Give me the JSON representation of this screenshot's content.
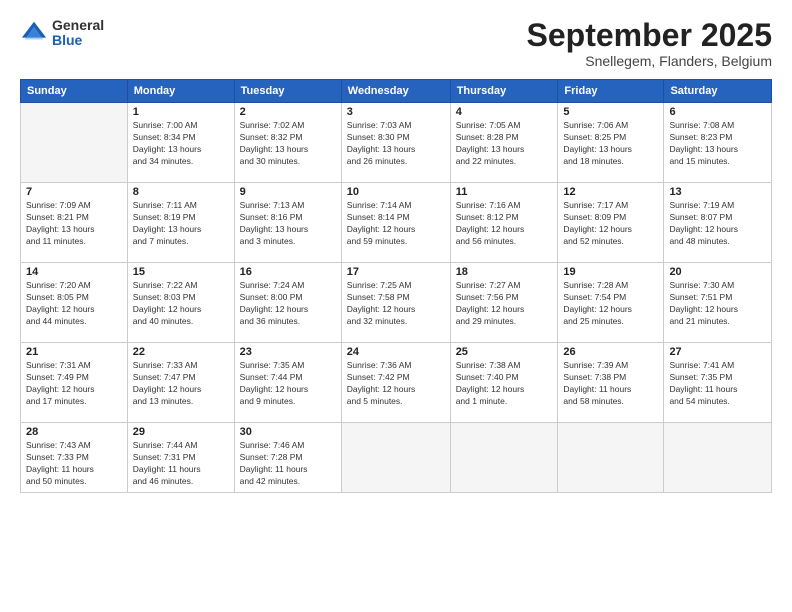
{
  "header": {
    "logo_general": "General",
    "logo_blue": "Blue",
    "month_title": "September 2025",
    "location": "Snellegem, Flanders, Belgium"
  },
  "weekdays": [
    "Sunday",
    "Monday",
    "Tuesday",
    "Wednesday",
    "Thursday",
    "Friday",
    "Saturday"
  ],
  "weeks": [
    [
      {
        "day": "",
        "info": ""
      },
      {
        "day": "1",
        "info": "Sunrise: 7:00 AM\nSunset: 8:34 PM\nDaylight: 13 hours\nand 34 minutes."
      },
      {
        "day": "2",
        "info": "Sunrise: 7:02 AM\nSunset: 8:32 PM\nDaylight: 13 hours\nand 30 minutes."
      },
      {
        "day": "3",
        "info": "Sunrise: 7:03 AM\nSunset: 8:30 PM\nDaylight: 13 hours\nand 26 minutes."
      },
      {
        "day": "4",
        "info": "Sunrise: 7:05 AM\nSunset: 8:28 PM\nDaylight: 13 hours\nand 22 minutes."
      },
      {
        "day": "5",
        "info": "Sunrise: 7:06 AM\nSunset: 8:25 PM\nDaylight: 13 hours\nand 18 minutes."
      },
      {
        "day": "6",
        "info": "Sunrise: 7:08 AM\nSunset: 8:23 PM\nDaylight: 13 hours\nand 15 minutes."
      }
    ],
    [
      {
        "day": "7",
        "info": "Sunrise: 7:09 AM\nSunset: 8:21 PM\nDaylight: 13 hours\nand 11 minutes."
      },
      {
        "day": "8",
        "info": "Sunrise: 7:11 AM\nSunset: 8:19 PM\nDaylight: 13 hours\nand 7 minutes."
      },
      {
        "day": "9",
        "info": "Sunrise: 7:13 AM\nSunset: 8:16 PM\nDaylight: 13 hours\nand 3 minutes."
      },
      {
        "day": "10",
        "info": "Sunrise: 7:14 AM\nSunset: 8:14 PM\nDaylight: 12 hours\nand 59 minutes."
      },
      {
        "day": "11",
        "info": "Sunrise: 7:16 AM\nSunset: 8:12 PM\nDaylight: 12 hours\nand 56 minutes."
      },
      {
        "day": "12",
        "info": "Sunrise: 7:17 AM\nSunset: 8:09 PM\nDaylight: 12 hours\nand 52 minutes."
      },
      {
        "day": "13",
        "info": "Sunrise: 7:19 AM\nSunset: 8:07 PM\nDaylight: 12 hours\nand 48 minutes."
      }
    ],
    [
      {
        "day": "14",
        "info": "Sunrise: 7:20 AM\nSunset: 8:05 PM\nDaylight: 12 hours\nand 44 minutes."
      },
      {
        "day": "15",
        "info": "Sunrise: 7:22 AM\nSunset: 8:03 PM\nDaylight: 12 hours\nand 40 minutes."
      },
      {
        "day": "16",
        "info": "Sunrise: 7:24 AM\nSunset: 8:00 PM\nDaylight: 12 hours\nand 36 minutes."
      },
      {
        "day": "17",
        "info": "Sunrise: 7:25 AM\nSunset: 7:58 PM\nDaylight: 12 hours\nand 32 minutes."
      },
      {
        "day": "18",
        "info": "Sunrise: 7:27 AM\nSunset: 7:56 PM\nDaylight: 12 hours\nand 29 minutes."
      },
      {
        "day": "19",
        "info": "Sunrise: 7:28 AM\nSunset: 7:54 PM\nDaylight: 12 hours\nand 25 minutes."
      },
      {
        "day": "20",
        "info": "Sunrise: 7:30 AM\nSunset: 7:51 PM\nDaylight: 12 hours\nand 21 minutes."
      }
    ],
    [
      {
        "day": "21",
        "info": "Sunrise: 7:31 AM\nSunset: 7:49 PM\nDaylight: 12 hours\nand 17 minutes."
      },
      {
        "day": "22",
        "info": "Sunrise: 7:33 AM\nSunset: 7:47 PM\nDaylight: 12 hours\nand 13 minutes."
      },
      {
        "day": "23",
        "info": "Sunrise: 7:35 AM\nSunset: 7:44 PM\nDaylight: 12 hours\nand 9 minutes."
      },
      {
        "day": "24",
        "info": "Sunrise: 7:36 AM\nSunset: 7:42 PM\nDaylight: 12 hours\nand 5 minutes."
      },
      {
        "day": "25",
        "info": "Sunrise: 7:38 AM\nSunset: 7:40 PM\nDaylight: 12 hours\nand 1 minute."
      },
      {
        "day": "26",
        "info": "Sunrise: 7:39 AM\nSunset: 7:38 PM\nDaylight: 11 hours\nand 58 minutes."
      },
      {
        "day": "27",
        "info": "Sunrise: 7:41 AM\nSunset: 7:35 PM\nDaylight: 11 hours\nand 54 minutes."
      }
    ],
    [
      {
        "day": "28",
        "info": "Sunrise: 7:43 AM\nSunset: 7:33 PM\nDaylight: 11 hours\nand 50 minutes."
      },
      {
        "day": "29",
        "info": "Sunrise: 7:44 AM\nSunset: 7:31 PM\nDaylight: 11 hours\nand 46 minutes."
      },
      {
        "day": "30",
        "info": "Sunrise: 7:46 AM\nSunset: 7:28 PM\nDaylight: 11 hours\nand 42 minutes."
      },
      {
        "day": "",
        "info": ""
      },
      {
        "day": "",
        "info": ""
      },
      {
        "day": "",
        "info": ""
      },
      {
        "day": "",
        "info": ""
      }
    ]
  ]
}
